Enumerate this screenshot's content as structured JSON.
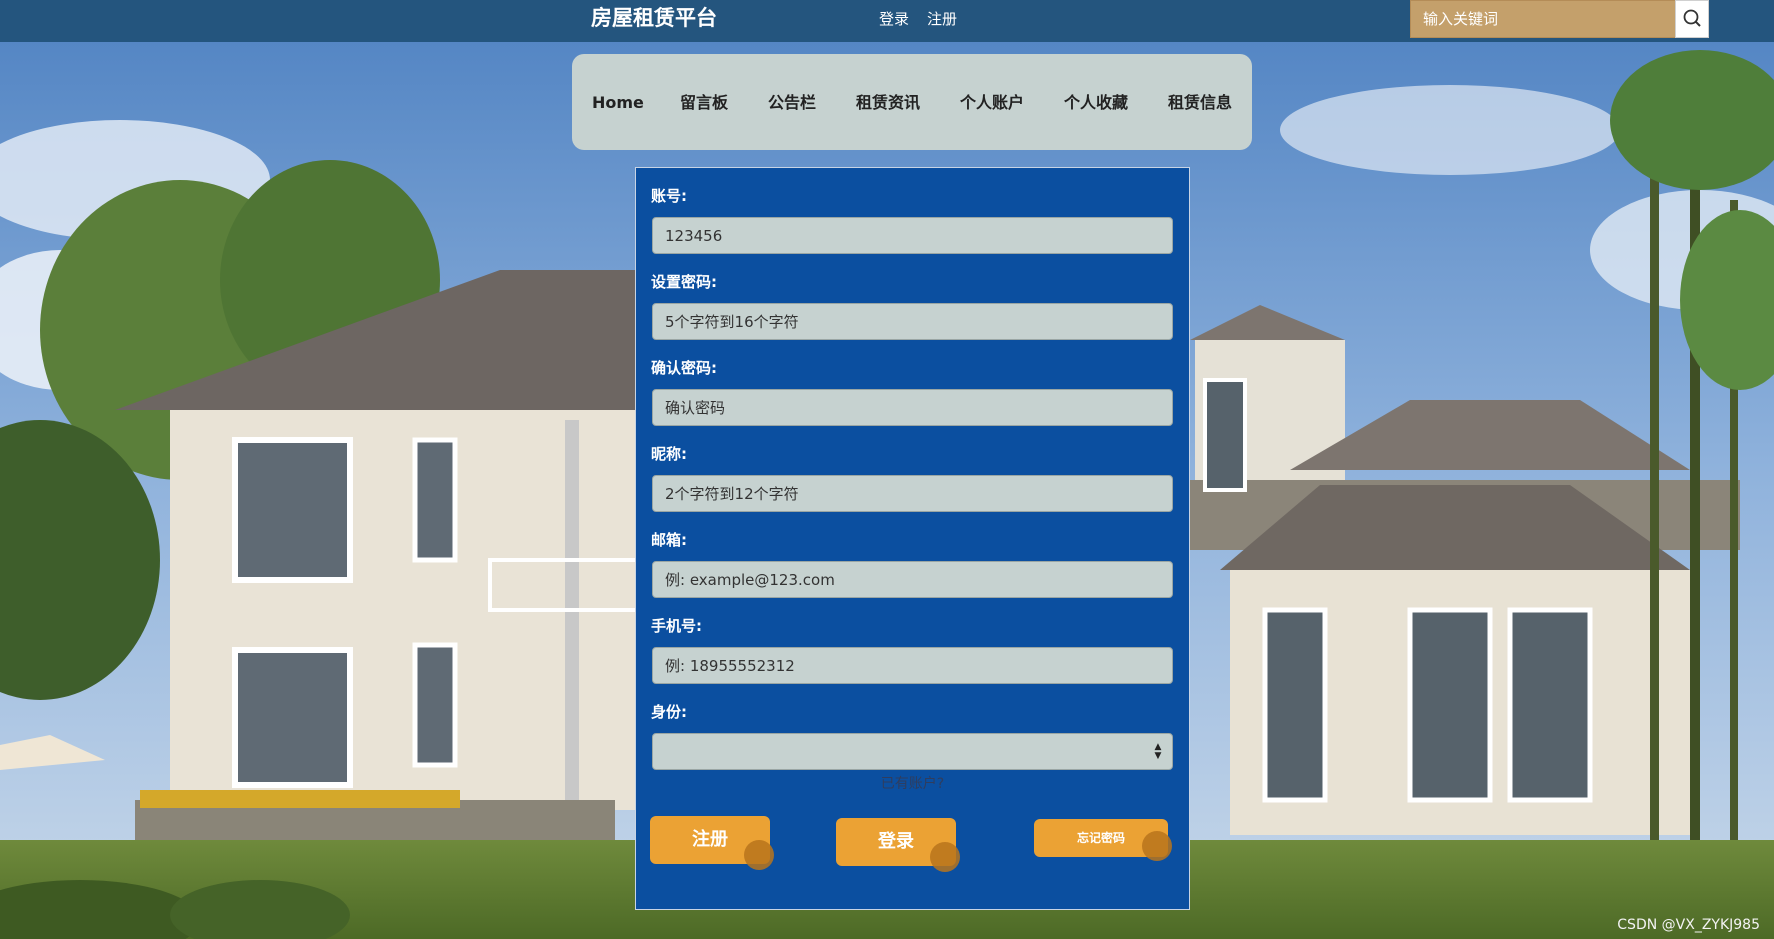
{
  "header": {
    "site_title": "房屋租赁平台",
    "login_link": "登录",
    "register_link": "注册",
    "search_placeholder": "输入关键词",
    "search_icon": "magnifier-icon"
  },
  "nav": {
    "items": [
      "Home",
      "留言板",
      "公告栏",
      "租赁资讯",
      "个人账户",
      "个人收藏",
      "租赁信息"
    ]
  },
  "form": {
    "fields": [
      {
        "label": "账号:",
        "placeholder": "123456"
      },
      {
        "label": "设置密码:",
        "placeholder": "5个字符到16个字符"
      },
      {
        "label": "确认密码:",
        "placeholder": "确认密码"
      },
      {
        "label": "昵称:",
        "placeholder": "2个字符到12个字符"
      },
      {
        "label": "邮箱:",
        "placeholder": "例: example@123.com"
      },
      {
        "label": "手机号:",
        "placeholder": "例: 18955552312"
      }
    ],
    "role_label": "身份:",
    "role_value": "",
    "have_account": "已有账户?",
    "register_button": "注册",
    "login_button": "登录",
    "forgot_button": "忘记密码"
  },
  "watermark": "CSDN @VX_ZYKJ985",
  "colors": {
    "topbar": "#24557e",
    "nav_bg": "#c6d2d0",
    "panel_bg": "#0b4fa0",
    "button": "#eba234",
    "search_bg": "#c4a06b"
  }
}
